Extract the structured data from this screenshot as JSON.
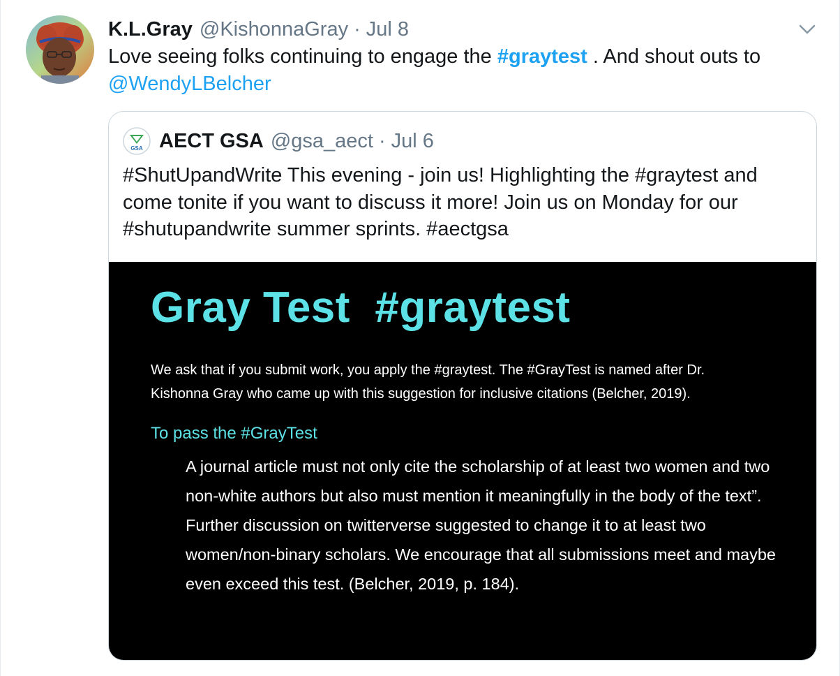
{
  "tweet": {
    "author_name": "K.L.Gray",
    "author_handle": "@KishonnaGray",
    "separator": "·",
    "date": "Jul 8",
    "text_before": "Love seeing folks continuing to engage the ",
    "hashtag": "#graytest",
    "text_after": " . And shout outs to ",
    "mention": "@WendyLBelcher",
    "menu_icon": "chevron-down-icon"
  },
  "quoted_tweet": {
    "logo_label": "GSA",
    "author_name": "AECT GSA",
    "author_handle": "@gsa_aect",
    "separator": "·",
    "date": "Jul 6",
    "text": "#ShutUpandWrite This evening - join us! Highlighting the #graytest and come tonite if you want to discuss it more! Join us on Monday for our #shutupandwrite summer sprints. #aectgsa"
  },
  "media": {
    "title": "Gray Test  #graytest",
    "intro": "We ask that if you submit work, you apply the #graytest. The #GrayTest is named after Dr. Kishonna Gray who came up with this suggestion for inclusive citations (Belcher, 2019).",
    "subtitle": "To pass the #GrayTest",
    "body": "A journal article must not only cite the scholarship of at least two women and two non-white authors but also must mention it meaningfully in the body of the text”. Further discussion on twitterverse suggested to change it to at least two women/non-binary scholars. We encourage that all submissions meet and maybe even exceed this test. (Belcher, 2019, p. 184).",
    "title_color": "#5ce1e6"
  },
  "colors": {
    "link": "#1da1f2",
    "muted": "#657786",
    "text": "#14171a",
    "border": "#ccd6dd"
  }
}
